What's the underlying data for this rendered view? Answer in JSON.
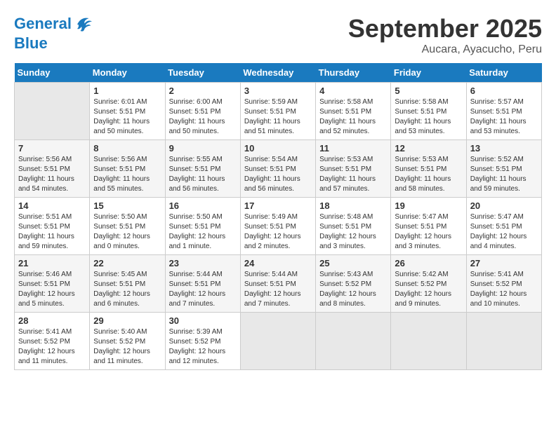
{
  "header": {
    "logo_line1": "General",
    "logo_line2": "Blue",
    "month": "September 2025",
    "location": "Aucara, Ayacucho, Peru"
  },
  "weekdays": [
    "Sunday",
    "Monday",
    "Tuesday",
    "Wednesday",
    "Thursday",
    "Friday",
    "Saturday"
  ],
  "weeks": [
    [
      {
        "day": "",
        "info": ""
      },
      {
        "day": "1",
        "info": "Sunrise: 6:01 AM\nSunset: 5:51 PM\nDaylight: 11 hours\nand 50 minutes."
      },
      {
        "day": "2",
        "info": "Sunrise: 6:00 AM\nSunset: 5:51 PM\nDaylight: 11 hours\nand 50 minutes."
      },
      {
        "day": "3",
        "info": "Sunrise: 5:59 AM\nSunset: 5:51 PM\nDaylight: 11 hours\nand 51 minutes."
      },
      {
        "day": "4",
        "info": "Sunrise: 5:58 AM\nSunset: 5:51 PM\nDaylight: 11 hours\nand 52 minutes."
      },
      {
        "day": "5",
        "info": "Sunrise: 5:58 AM\nSunset: 5:51 PM\nDaylight: 11 hours\nand 53 minutes."
      },
      {
        "day": "6",
        "info": "Sunrise: 5:57 AM\nSunset: 5:51 PM\nDaylight: 11 hours\nand 53 minutes."
      }
    ],
    [
      {
        "day": "7",
        "info": "Sunrise: 5:56 AM\nSunset: 5:51 PM\nDaylight: 11 hours\nand 54 minutes."
      },
      {
        "day": "8",
        "info": "Sunrise: 5:56 AM\nSunset: 5:51 PM\nDaylight: 11 hours\nand 55 minutes."
      },
      {
        "day": "9",
        "info": "Sunrise: 5:55 AM\nSunset: 5:51 PM\nDaylight: 11 hours\nand 56 minutes."
      },
      {
        "day": "10",
        "info": "Sunrise: 5:54 AM\nSunset: 5:51 PM\nDaylight: 11 hours\nand 56 minutes."
      },
      {
        "day": "11",
        "info": "Sunrise: 5:53 AM\nSunset: 5:51 PM\nDaylight: 11 hours\nand 57 minutes."
      },
      {
        "day": "12",
        "info": "Sunrise: 5:53 AM\nSunset: 5:51 PM\nDaylight: 11 hours\nand 58 minutes."
      },
      {
        "day": "13",
        "info": "Sunrise: 5:52 AM\nSunset: 5:51 PM\nDaylight: 11 hours\nand 59 minutes."
      }
    ],
    [
      {
        "day": "14",
        "info": "Sunrise: 5:51 AM\nSunset: 5:51 PM\nDaylight: 11 hours\nand 59 minutes."
      },
      {
        "day": "15",
        "info": "Sunrise: 5:50 AM\nSunset: 5:51 PM\nDaylight: 12 hours\nand 0 minutes."
      },
      {
        "day": "16",
        "info": "Sunrise: 5:50 AM\nSunset: 5:51 PM\nDaylight: 12 hours\nand 1 minute."
      },
      {
        "day": "17",
        "info": "Sunrise: 5:49 AM\nSunset: 5:51 PM\nDaylight: 12 hours\nand 2 minutes."
      },
      {
        "day": "18",
        "info": "Sunrise: 5:48 AM\nSunset: 5:51 PM\nDaylight: 12 hours\nand 3 minutes."
      },
      {
        "day": "19",
        "info": "Sunrise: 5:47 AM\nSunset: 5:51 PM\nDaylight: 12 hours\nand 3 minutes."
      },
      {
        "day": "20",
        "info": "Sunrise: 5:47 AM\nSunset: 5:51 PM\nDaylight: 12 hours\nand 4 minutes."
      }
    ],
    [
      {
        "day": "21",
        "info": "Sunrise: 5:46 AM\nSunset: 5:51 PM\nDaylight: 12 hours\nand 5 minutes."
      },
      {
        "day": "22",
        "info": "Sunrise: 5:45 AM\nSunset: 5:51 PM\nDaylight: 12 hours\nand 6 minutes."
      },
      {
        "day": "23",
        "info": "Sunrise: 5:44 AM\nSunset: 5:51 PM\nDaylight: 12 hours\nand 7 minutes."
      },
      {
        "day": "24",
        "info": "Sunrise: 5:44 AM\nSunset: 5:51 PM\nDaylight: 12 hours\nand 7 minutes."
      },
      {
        "day": "25",
        "info": "Sunrise: 5:43 AM\nSunset: 5:52 PM\nDaylight: 12 hours\nand 8 minutes."
      },
      {
        "day": "26",
        "info": "Sunrise: 5:42 AM\nSunset: 5:52 PM\nDaylight: 12 hours\nand 9 minutes."
      },
      {
        "day": "27",
        "info": "Sunrise: 5:41 AM\nSunset: 5:52 PM\nDaylight: 12 hours\nand 10 minutes."
      }
    ],
    [
      {
        "day": "28",
        "info": "Sunrise: 5:41 AM\nSunset: 5:52 PM\nDaylight: 12 hours\nand 11 minutes."
      },
      {
        "day": "29",
        "info": "Sunrise: 5:40 AM\nSunset: 5:52 PM\nDaylight: 12 hours\nand 11 minutes."
      },
      {
        "day": "30",
        "info": "Sunrise: 5:39 AM\nSunset: 5:52 PM\nDaylight: 12 hours\nand 12 minutes."
      },
      {
        "day": "",
        "info": ""
      },
      {
        "day": "",
        "info": ""
      },
      {
        "day": "",
        "info": ""
      },
      {
        "day": "",
        "info": ""
      }
    ]
  ]
}
